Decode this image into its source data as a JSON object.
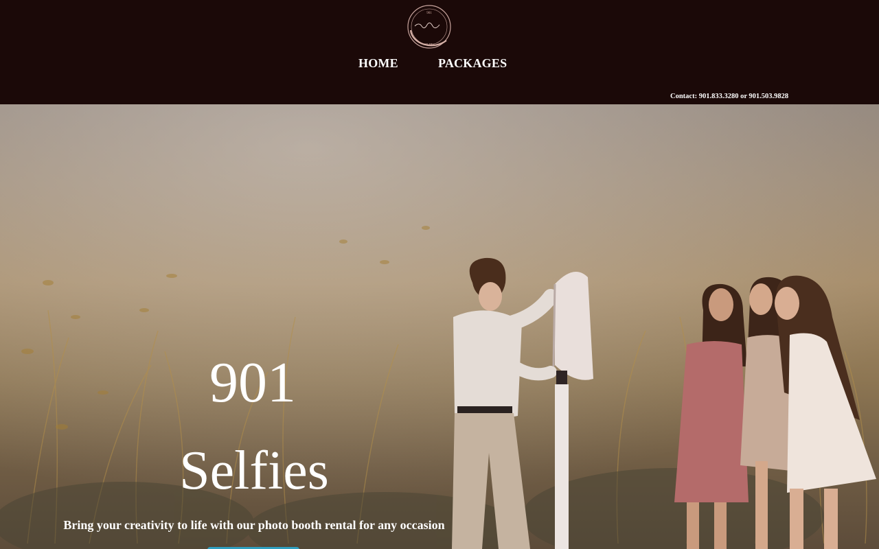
{
  "header": {
    "logo_alt": "901 Selfies logo",
    "nav": [
      {
        "label": "HOME"
      },
      {
        "label": "PACKAGES"
      }
    ],
    "contact": "Contact: 901.833.3280 or 901.503.9828"
  },
  "hero": {
    "title_line1": "901",
    "title_line2": "Selfies",
    "tagline": "Bring your creativity to life with our photo booth rental for any occasion"
  },
  "colors": {
    "header_bg": "#1b0908",
    "text": "#ffffff",
    "cta": "#2f9fc0"
  }
}
